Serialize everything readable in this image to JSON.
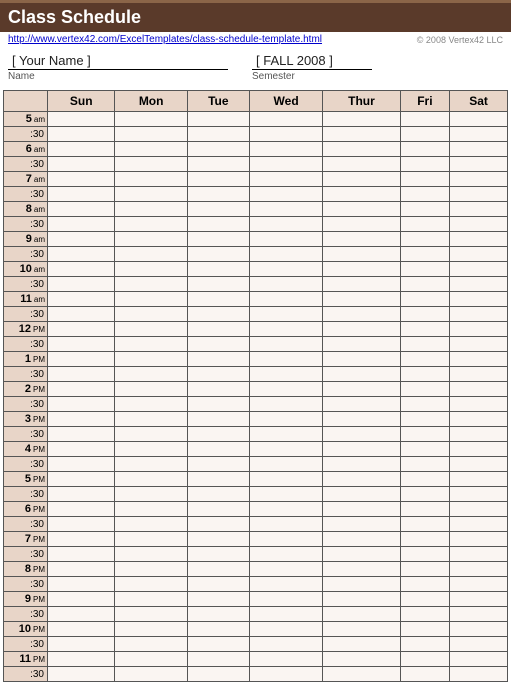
{
  "title": "Class Schedule",
  "source_link": "http://www.vertex42.com/ExcelTemplates/class-schedule-template.html",
  "copyright": "© 2008 Vertex42 LLC",
  "name_field": {
    "value": "[  Your Name  ]",
    "label": "Name"
  },
  "semester_field": {
    "value": "[  FALL 2008  ]",
    "label": "Semester"
  },
  "days": [
    "Sun",
    "Mon",
    "Tue",
    "Wed",
    "Thur",
    "Fri",
    "Sat"
  ],
  "half_label": ":30",
  "hours": [
    {
      "h": "5",
      "ap": "am"
    },
    {
      "h": "6",
      "ap": "am"
    },
    {
      "h": "7",
      "ap": "am"
    },
    {
      "h": "8",
      "ap": "am"
    },
    {
      "h": "9",
      "ap": "am"
    },
    {
      "h": "10",
      "ap": "am"
    },
    {
      "h": "11",
      "ap": "am"
    },
    {
      "h": "12",
      "ap": "PM"
    },
    {
      "h": "1",
      "ap": "PM"
    },
    {
      "h": "2",
      "ap": "PM"
    },
    {
      "h": "3",
      "ap": "PM"
    },
    {
      "h": "4",
      "ap": "PM"
    },
    {
      "h": "5",
      "ap": "PM"
    },
    {
      "h": "6",
      "ap": "PM"
    },
    {
      "h": "7",
      "ap": "PM"
    },
    {
      "h": "8",
      "ap": "PM"
    },
    {
      "h": "9",
      "ap": "PM"
    },
    {
      "h": "10",
      "ap": "PM"
    },
    {
      "h": "11",
      "ap": "PM"
    }
  ]
}
